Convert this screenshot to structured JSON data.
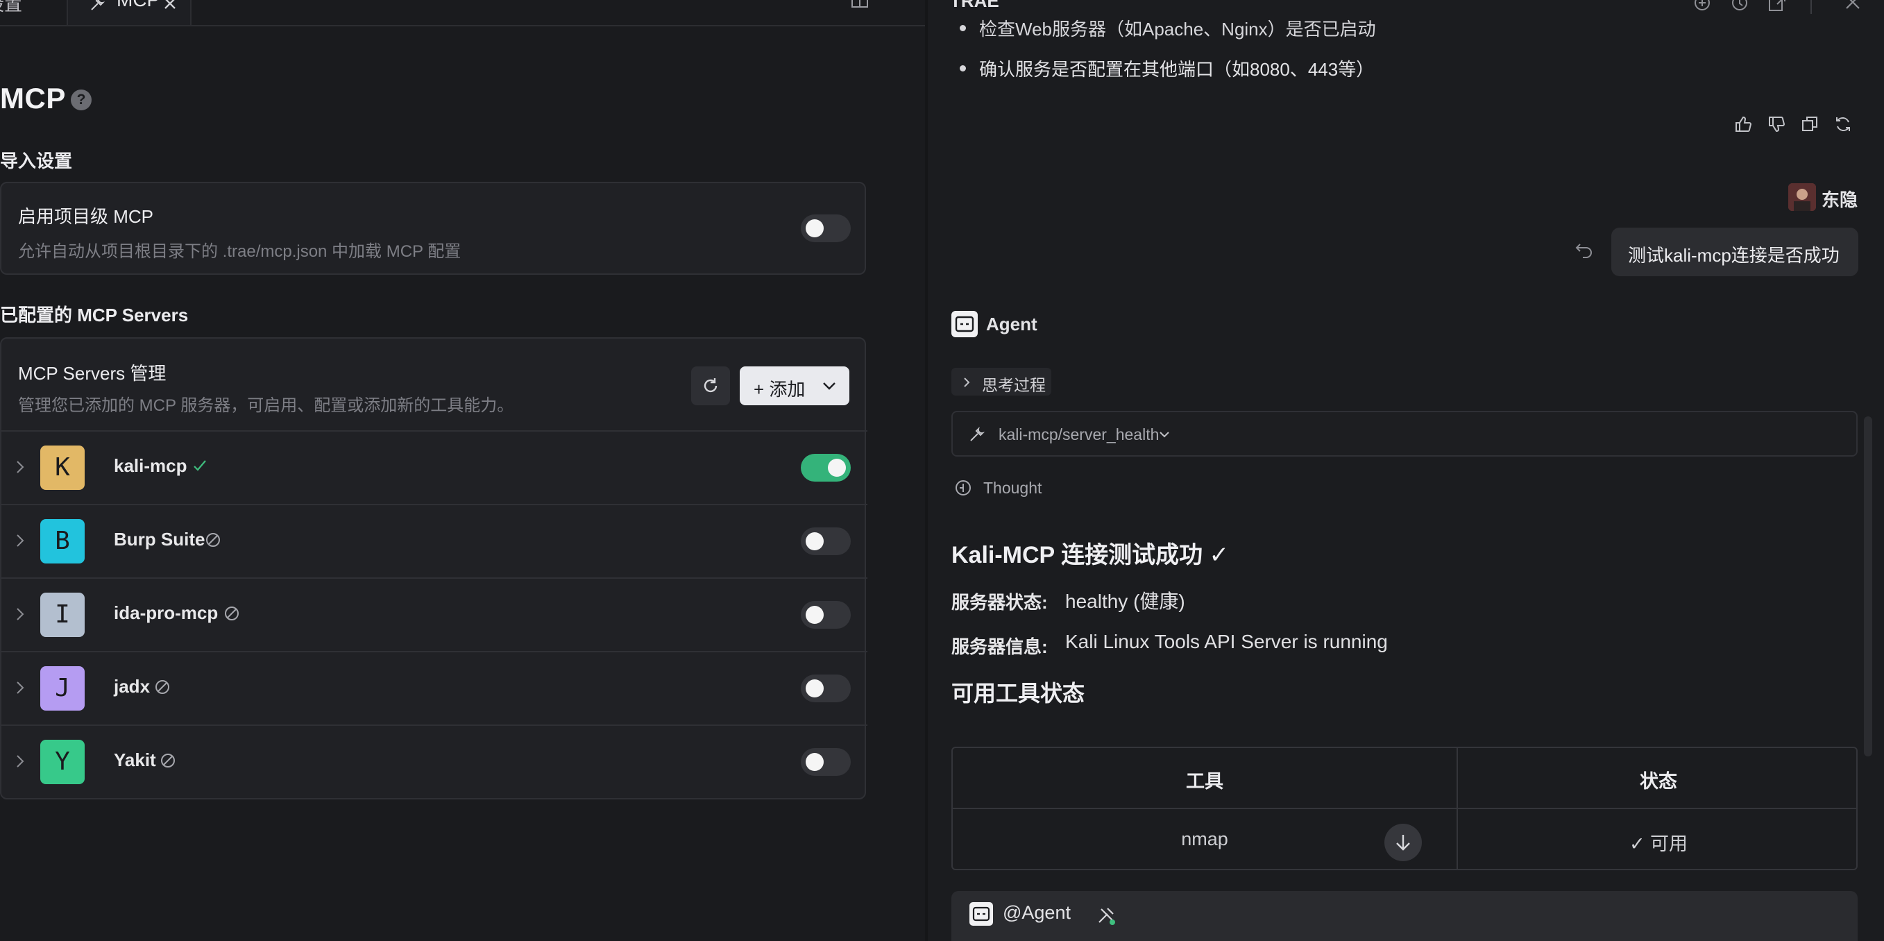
{
  "left_panel": {
    "tabs": [
      {
        "label": "设置"
      },
      {
        "label": "MCP"
      }
    ],
    "title": "MCP",
    "import_section": {
      "heading": "导入设置",
      "project_mcp": {
        "title": "启用项目级 MCP",
        "description": "允许自动从项目根目录下的 .trae/mcp.json 中加载 MCP 配置",
        "enabled": false
      }
    },
    "configured_section": {
      "heading": "已配置的 MCP Servers",
      "manager": {
        "title": "MCP Servers 管理",
        "description": "管理您已添加的 MCP 服务器，可启用、配置或添加新的工具能力。",
        "add_label": "+ 添加"
      },
      "servers": [
        {
          "letter": "K",
          "name": "kali-mcp",
          "status": "connected",
          "enabled": true,
          "color": "#e2b866"
        },
        {
          "letter": "B",
          "name": "Burp Suite",
          "status": "disabled",
          "enabled": false,
          "color": "#22c3dd"
        },
        {
          "letter": "I",
          "name": "ida-pro-mcp",
          "status": "disabled",
          "enabled": false,
          "color": "#b3bfcf"
        },
        {
          "letter": "J",
          "name": "jadx",
          "status": "disabled",
          "enabled": false,
          "color": "#b59cf2"
        },
        {
          "letter": "Y",
          "name": "Yakit",
          "status": "disabled",
          "enabled": false,
          "color": "#37c98a"
        }
      ]
    }
  },
  "right_panel": {
    "title": "TRAE",
    "prev_bullet_cut": "检查Web服务器（如Apache、Nginx）是否已启动",
    "prev_bullet": "确认服务是否配置在其他端口（如8080、443等）",
    "user": {
      "name": "东隐",
      "message": "测试kali-mcp连接是否成功"
    },
    "agent": {
      "name": "Agent",
      "thinking_label": "思考过程",
      "tool_call": "kali-mcp/server_health",
      "thought_label": "Thought",
      "heading": "Kali-MCP 连接测试成功 ✓",
      "status_key": "服务器状态:",
      "status_value": "healthy (健康)",
      "info_key": "服务器信息:",
      "info_value": "Kali Linux Tools API Server is running",
      "tools_heading": "可用工具状态",
      "table": {
        "headers": [
          "工具",
          "状态"
        ],
        "rows": [
          [
            "nmap",
            "✓ 可用"
          ]
        ]
      }
    },
    "input": {
      "mention": "@Agent"
    }
  },
  "colors": {
    "background": "#1a1b1e",
    "toggle_on": "#34b37a",
    "toggle_off": "#34353a",
    "ok_check": "#3fbf7f"
  }
}
